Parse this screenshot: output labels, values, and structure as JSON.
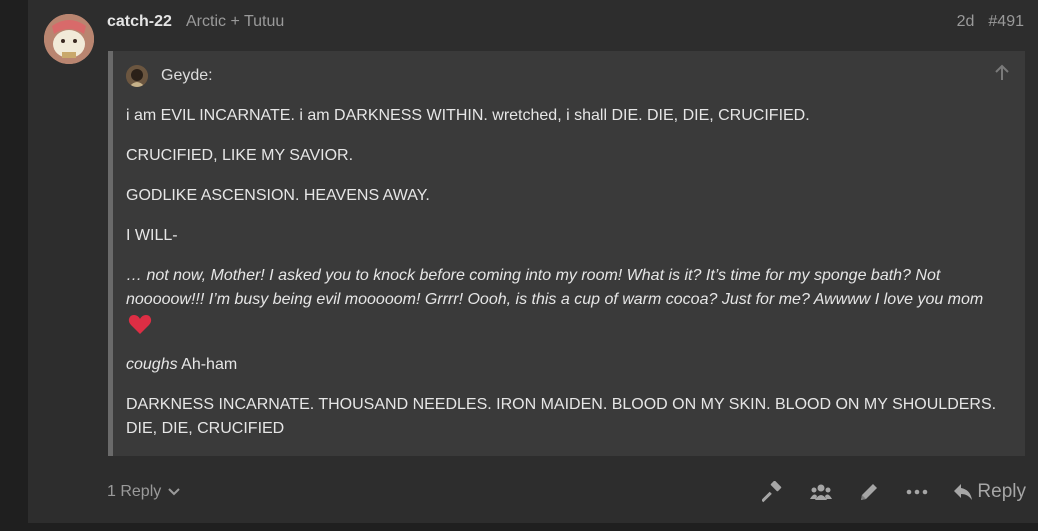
{
  "post": {
    "username": "catch-22",
    "user_title": "Arctic + Tutuu",
    "age": "2d",
    "number": "#491"
  },
  "quote": {
    "author": "Geyde:",
    "paragraphs": [
      "i am EVIL INCARNATE. i am DARKNESS WITHIN. wretched, i shall DIE. DIE, DIE, CRUCIFIED.",
      "CRUCIFIED, LIKE MY SAVIOR.",
      "GODLIKE ASCENSION. HEAVENS AWAY.",
      "I WILL-",
      "… not now, Mother! I asked you to knock before coming into my room! What is it? It’s time for my sponge bath? Not nooooow!!! I’m busy being evil mooooom! Grrrr! Oooh, is this a cup of warm cocoa? Just for me? Awwww I love you mom",
      "coughs",
      "Ah-ham",
      "DARKNESS INCARNATE. THOUSAND NEEDLES. IRON MAIDEN. BLOOD ON MY SKIN. BLOOD ON MY SHOULDERS. DIE, DIE, CRUCIFIED"
    ]
  },
  "footer": {
    "replies_label": "1 Reply",
    "reply_label": "Reply"
  },
  "icons": {
    "admin": "hammer-icon",
    "group": "people-icon",
    "edit": "pencil-icon",
    "more": "ellipsis-icon",
    "reply": "reply-arrow-icon",
    "heart": "heart-icon"
  },
  "colors": {
    "heart": "#dd2e44"
  }
}
